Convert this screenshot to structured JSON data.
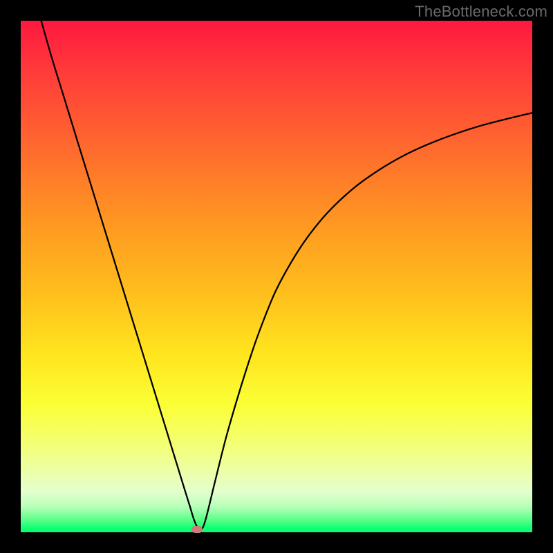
{
  "watermark": "TheBottleneck.com",
  "chart_data": {
    "type": "line",
    "title": "",
    "xlabel": "",
    "ylabel": "",
    "xlim": [
      0,
      100
    ],
    "ylim": [
      0,
      100
    ],
    "grid": false,
    "series": [
      {
        "name": "bottleneck-curve",
        "x": [
          4,
          6,
          8,
          10,
          12,
          14,
          16,
          18,
          20,
          22,
          24,
          26,
          28,
          30,
          32,
          33,
          34,
          35,
          36,
          38,
          40,
          42,
          44,
          46,
          48,
          50,
          53,
          56,
          60,
          65,
          70,
          75,
          80,
          85,
          90,
          95,
          100
        ],
        "values": [
          100,
          93,
          86.5,
          80,
          73.5,
          67,
          60.5,
          54,
          47.5,
          41,
          34.5,
          28,
          21.5,
          15,
          8.5,
          5.3,
          2.1,
          0.5,
          2,
          10,
          18,
          25,
          31.5,
          37.5,
          42.8,
          47.5,
          53,
          57.6,
          62.5,
          67.2,
          70.8,
          73.7,
          76,
          77.9,
          79.5,
          80.8,
          82
        ]
      }
    ],
    "annotations": [
      {
        "name": "min-marker",
        "x": 34.5,
        "y": 0.5,
        "color": "#cb7d78"
      }
    ],
    "background_gradient": {
      "top": "#ff183f",
      "bottom": "#00ff6d"
    }
  }
}
